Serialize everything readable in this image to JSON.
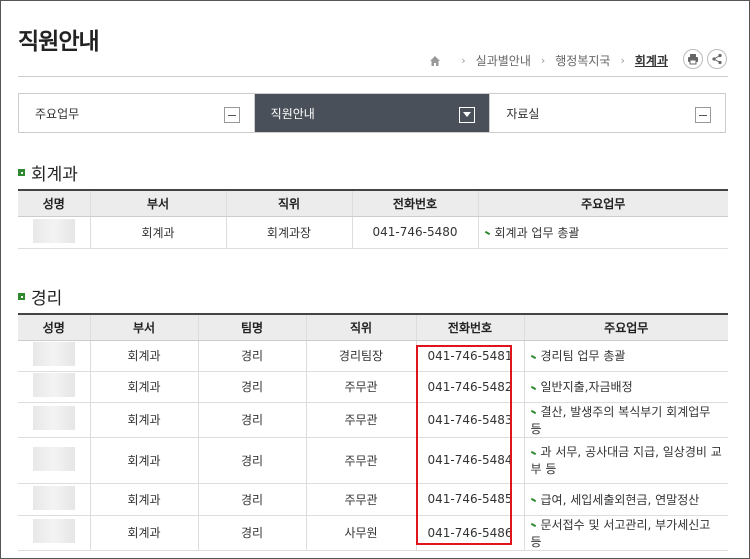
{
  "page": {
    "title": "직원안내"
  },
  "breadcrumb": {
    "items": [
      "실과별안내",
      "행정복지국",
      "회계과"
    ]
  },
  "tabs": [
    {
      "label": "주요업무",
      "active": false
    },
    {
      "label": "직원안내",
      "active": true
    },
    {
      "label": "자료실",
      "active": false
    }
  ],
  "accounting": {
    "title": "회계과",
    "headers": [
      "성명",
      "부서",
      "직위",
      "전화번호",
      "주요업무"
    ],
    "rows": [
      {
        "name": "",
        "dept": "회계과",
        "position": "회계과장",
        "phone": "041-746-5480",
        "duty": "회계과 업무 총괄"
      }
    ]
  },
  "management": {
    "title": "경리",
    "headers": [
      "성명",
      "부서",
      "팀명",
      "직위",
      "전화번호",
      "주요업무"
    ],
    "rows": [
      {
        "name": "",
        "dept": "회계과",
        "team": "경리",
        "position": "경리팀장",
        "phone": "041-746-5481",
        "duty": "경리팀 업무 총괄"
      },
      {
        "name": "",
        "dept": "회계과",
        "team": "경리",
        "position": "주무관",
        "phone": "041-746-5482",
        "duty": "일반지출,자금배정"
      },
      {
        "name": "",
        "dept": "회계과",
        "team": "경리",
        "position": "주무관",
        "phone": "041-746-5483",
        "duty": "결산, 발생주의 복식부기 회계업무 등"
      },
      {
        "name": "",
        "dept": "회계과",
        "team": "경리",
        "position": "주무관",
        "phone": "041-746-5484",
        "duty": "과 서무, 공사대금 지급, 일상경비 교부 등"
      },
      {
        "name": "",
        "dept": "회계과",
        "team": "경리",
        "position": "주무관",
        "phone": "041-746-5485",
        "duty": "급여, 세입세출외현금, 연말정산"
      },
      {
        "name": "",
        "dept": "회계과",
        "team": "경리",
        "position": "사무원",
        "phone": "041-746-5486",
        "duty": "문서접수 및 서고관리, 부가세신고 등"
      }
    ]
  },
  "colors": {
    "accent": "#2f8a2f",
    "active_tab": "#4a5059",
    "highlight": "#e0141b"
  },
  "icons": {
    "home": "home-icon",
    "print": "print-icon",
    "share": "share-icon"
  }
}
